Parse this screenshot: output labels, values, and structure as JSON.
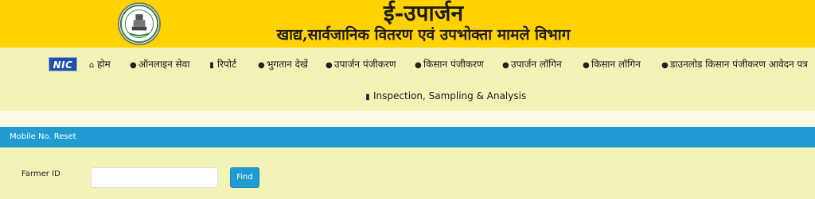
{
  "header": {
    "title": "ई-उपार्जन",
    "subtitle": "खाद्य,सार्वजानिक वितरण एवं उपभोक्ता मामले विभाग"
  },
  "nav": {
    "logo": "NIC",
    "items": [
      {
        "label": "होम",
        "icon": "home-icon"
      },
      {
        "label": "ऑनलाइन सेवा",
        "icon": "user-icon"
      },
      {
        "label": "रिपोर्ट",
        "icon": "file-icon"
      },
      {
        "label": "भुगतान देखें",
        "icon": "user-icon"
      },
      {
        "label": "उपार्जन पंजीकरण",
        "icon": "user-icon"
      },
      {
        "label": "किसान पंजीकरण",
        "icon": "user-icon"
      },
      {
        "label": "उपार्जन लॉगिन",
        "icon": "user-icon"
      },
      {
        "label": "किसान लॉगिन",
        "icon": "user-icon"
      },
      {
        "label": "डाउनलोड किसान पंजीकरण आवेदन पत्र",
        "icon": "user-icon"
      },
      {
        "label": "Inspection, Sampling & Analysis",
        "icon": "file-icon"
      }
    ]
  },
  "panel": {
    "heading": "Mobile No. Reset",
    "farmer_id_label": "Farmer ID",
    "farmer_id_value": "",
    "find_label": "Find"
  }
}
